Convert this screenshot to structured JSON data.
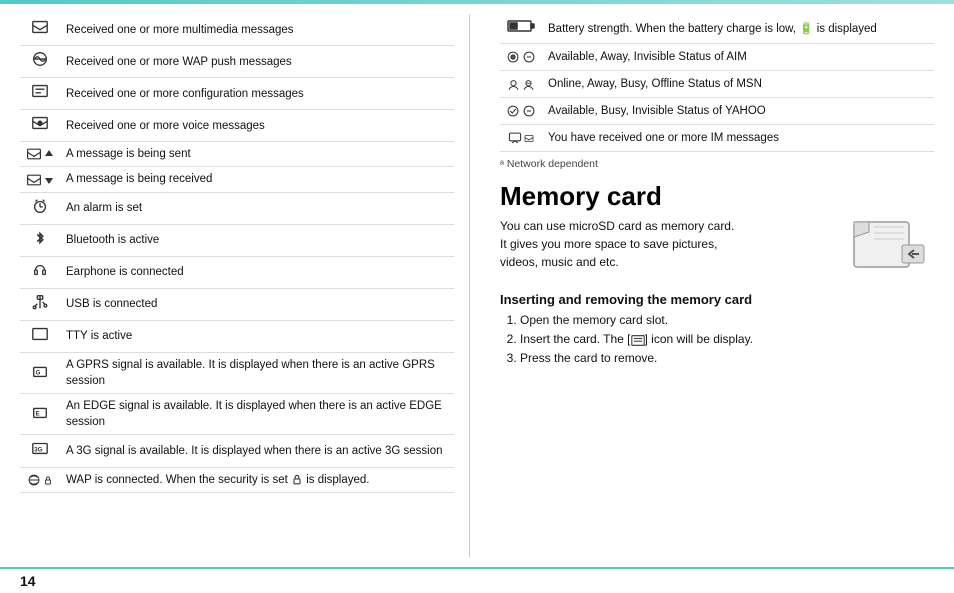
{
  "topLine": true,
  "leftTable": {
    "rows": [
      {
        "icon": "multimedia",
        "text": "Received one or more multimedia messages"
      },
      {
        "icon": "wap",
        "text": "Received one or more WAP push messages"
      },
      {
        "icon": "config",
        "text": "Received one or more configuration messages"
      },
      {
        "icon": "voice",
        "text": "Received one or more voice messages"
      },
      {
        "icon": "sending",
        "text": "A message is being sent"
      },
      {
        "icon": "receiving",
        "text": "A message is being received"
      },
      {
        "icon": "alarm",
        "text": "An alarm is set"
      },
      {
        "icon": "bluetooth",
        "text": "Bluetooth is active"
      },
      {
        "icon": "earphone",
        "text": "Earphone is connected"
      },
      {
        "icon": "usb",
        "text": "USB is connected"
      },
      {
        "icon": "tty",
        "text": "TTY is active"
      },
      {
        "icon": "gprs",
        "text": "A GPRS signal is available. It is displayed when there is an active GPRS session"
      },
      {
        "icon": "edge",
        "text": "An EDGE signal is available. It is displayed when there is an active EDGE session"
      },
      {
        "icon": "3g",
        "text": "A 3G signal is available. It is displayed when there is an active 3G session"
      },
      {
        "icon": "wap-security",
        "text": "WAP is connected. When the security is set 🔒 is displayed."
      }
    ]
  },
  "rightTable": {
    "rows": [
      {
        "icon": "battery",
        "text": "Battery strength. When the battery charge is low, 🔋 is displayed"
      },
      {
        "icon": "aim",
        "text": "Available, Away, Invisible Status of AIM"
      },
      {
        "icon": "msn",
        "text": "Online, Away, Busy, Offline Status of MSN"
      },
      {
        "icon": "yahoo",
        "text": "Available, Busy, Invisible Status of YAHOO"
      },
      {
        "icon": "im",
        "text": "You have received one or more IM messages"
      }
    ]
  },
  "networkNote": "ᵃ Network dependent",
  "memoryCard": {
    "title": "Memory card",
    "body": "You can use microSD card as memory card.\nIt gives you more space to save pictures,\nvideos, music and etc.",
    "insertingTitle": "Inserting and removing the memory card",
    "steps": [
      "Open the memory card slot.",
      "Insert the card. The [📋] icon will be display.",
      "Press the card to remove."
    ]
  },
  "pageNumber": "14"
}
